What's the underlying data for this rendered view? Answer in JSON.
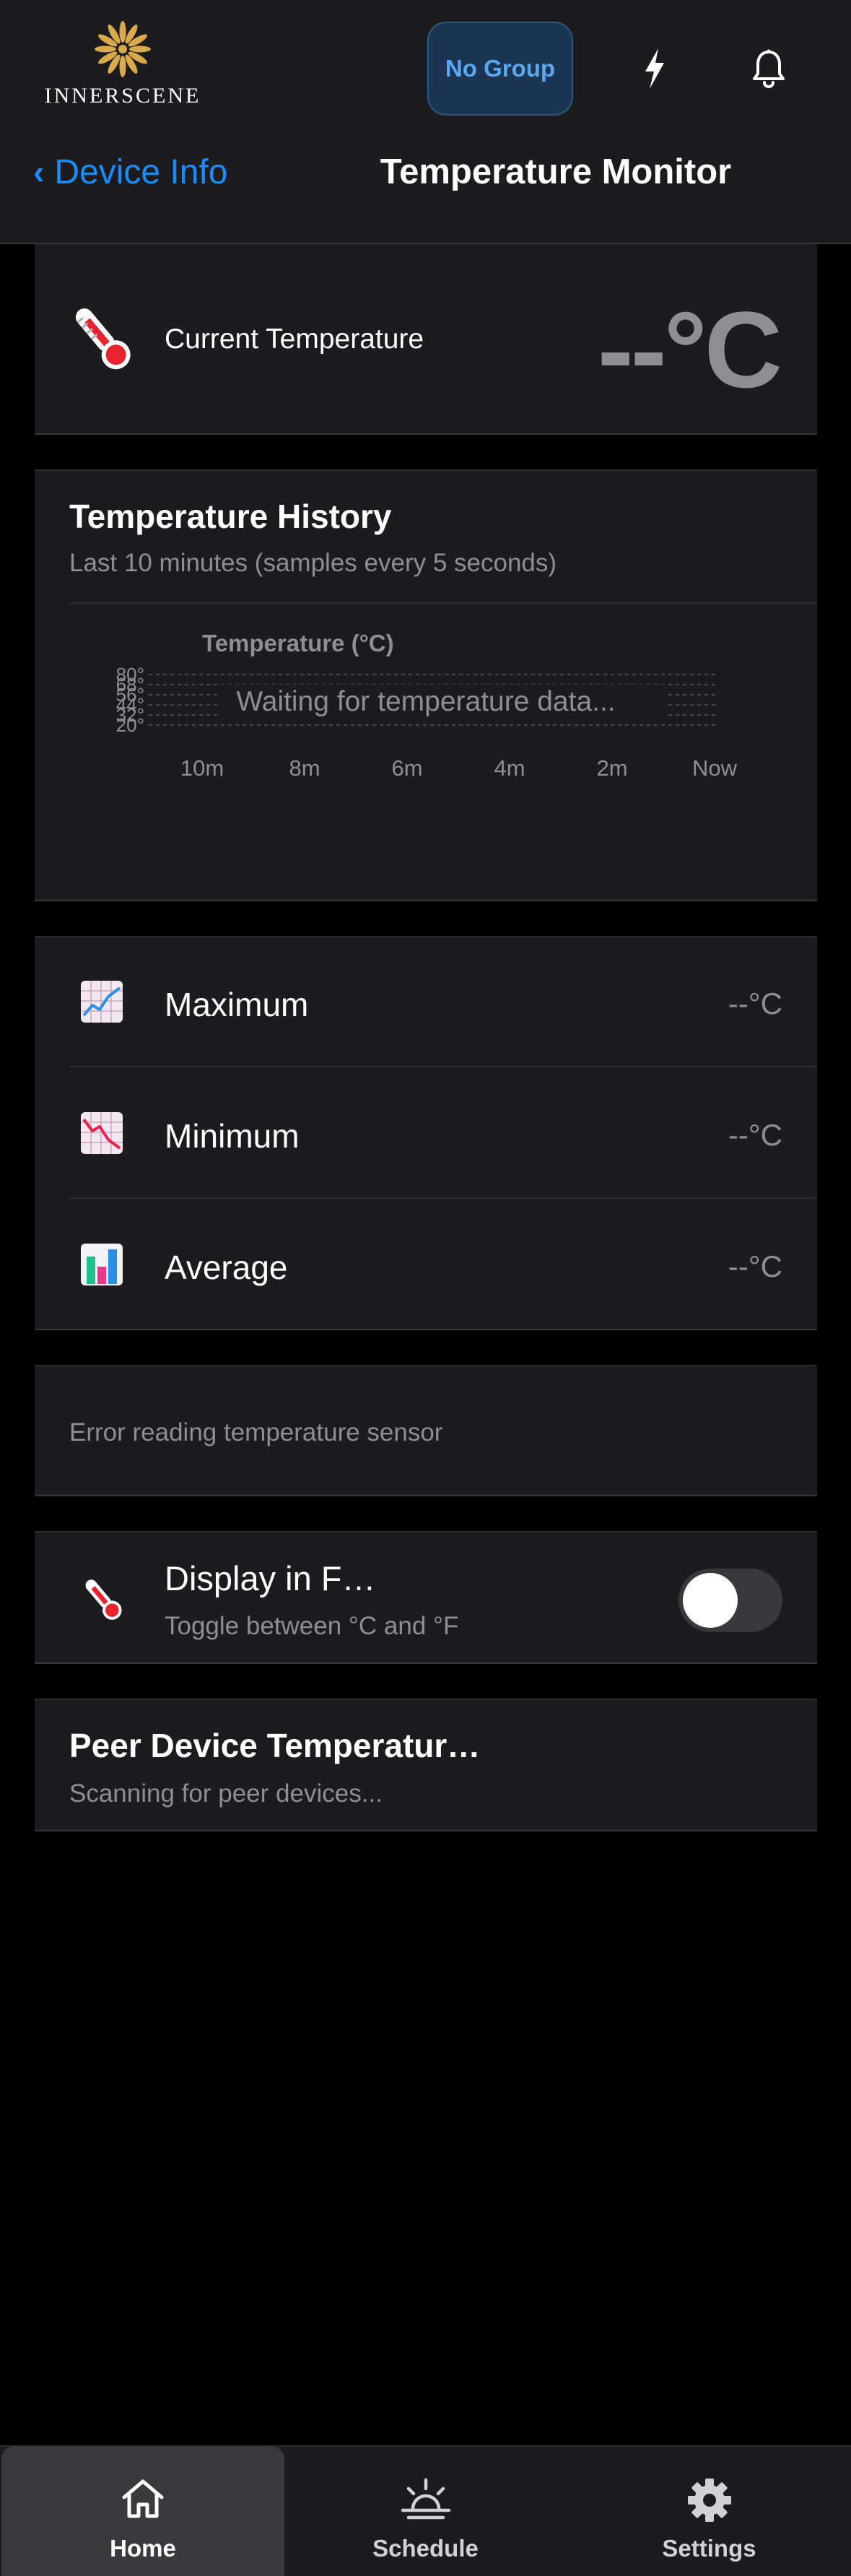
{
  "header": {
    "logo_text": "INNERSCENE",
    "group_button_label": "No Group"
  },
  "nav": {
    "back_label": "Device Info",
    "title": "Temperature Monitor"
  },
  "current": {
    "label": "Current Temperature",
    "value": "--°C"
  },
  "history": {
    "title": "Temperature History",
    "subtitle": "Last 10 minutes (samples every 5 seconds)",
    "chart_data": {
      "type": "line",
      "title": "Temperature (°C)",
      "y_ticks": [
        "80°",
        "68°",
        "56°",
        "44°",
        "32°",
        "20°"
      ],
      "x_ticks": [
        "10m",
        "8m",
        "6m",
        "4m",
        "2m",
        "Now"
      ],
      "ylim": [
        20,
        80
      ],
      "grid": true,
      "series": [],
      "placeholder": "Waiting for temperature data..."
    }
  },
  "stats": [
    {
      "label": "Maximum",
      "value": "--°C",
      "icon": "chart-up-icon"
    },
    {
      "label": "Minimum",
      "value": "--°C",
      "icon": "chart-down-icon"
    },
    {
      "label": "Average",
      "value": "--°C",
      "icon": "bar-chart-icon"
    }
  ],
  "error": {
    "message": "Error reading temperature sensor"
  },
  "unit_toggle": {
    "label": "Display in F…",
    "subtitle": "Toggle between °C and °F",
    "on": false
  },
  "peer": {
    "title": "Peer Device Temperatur…",
    "status": "Scanning for peer devices..."
  },
  "tabs": [
    {
      "label": "Home",
      "icon": "home-icon",
      "active": true
    },
    {
      "label": "Schedule",
      "icon": "sunrise-icon",
      "active": false
    },
    {
      "label": "Settings",
      "icon": "gear-icon",
      "active": false
    }
  ],
  "colors": {
    "accent_blue": "#1a8cff",
    "card_bg": "#1c1c1e",
    "secondary_text": "#8e8e93",
    "logo_gold": "#d9a94e",
    "thermometer_red": "#e8232e"
  }
}
